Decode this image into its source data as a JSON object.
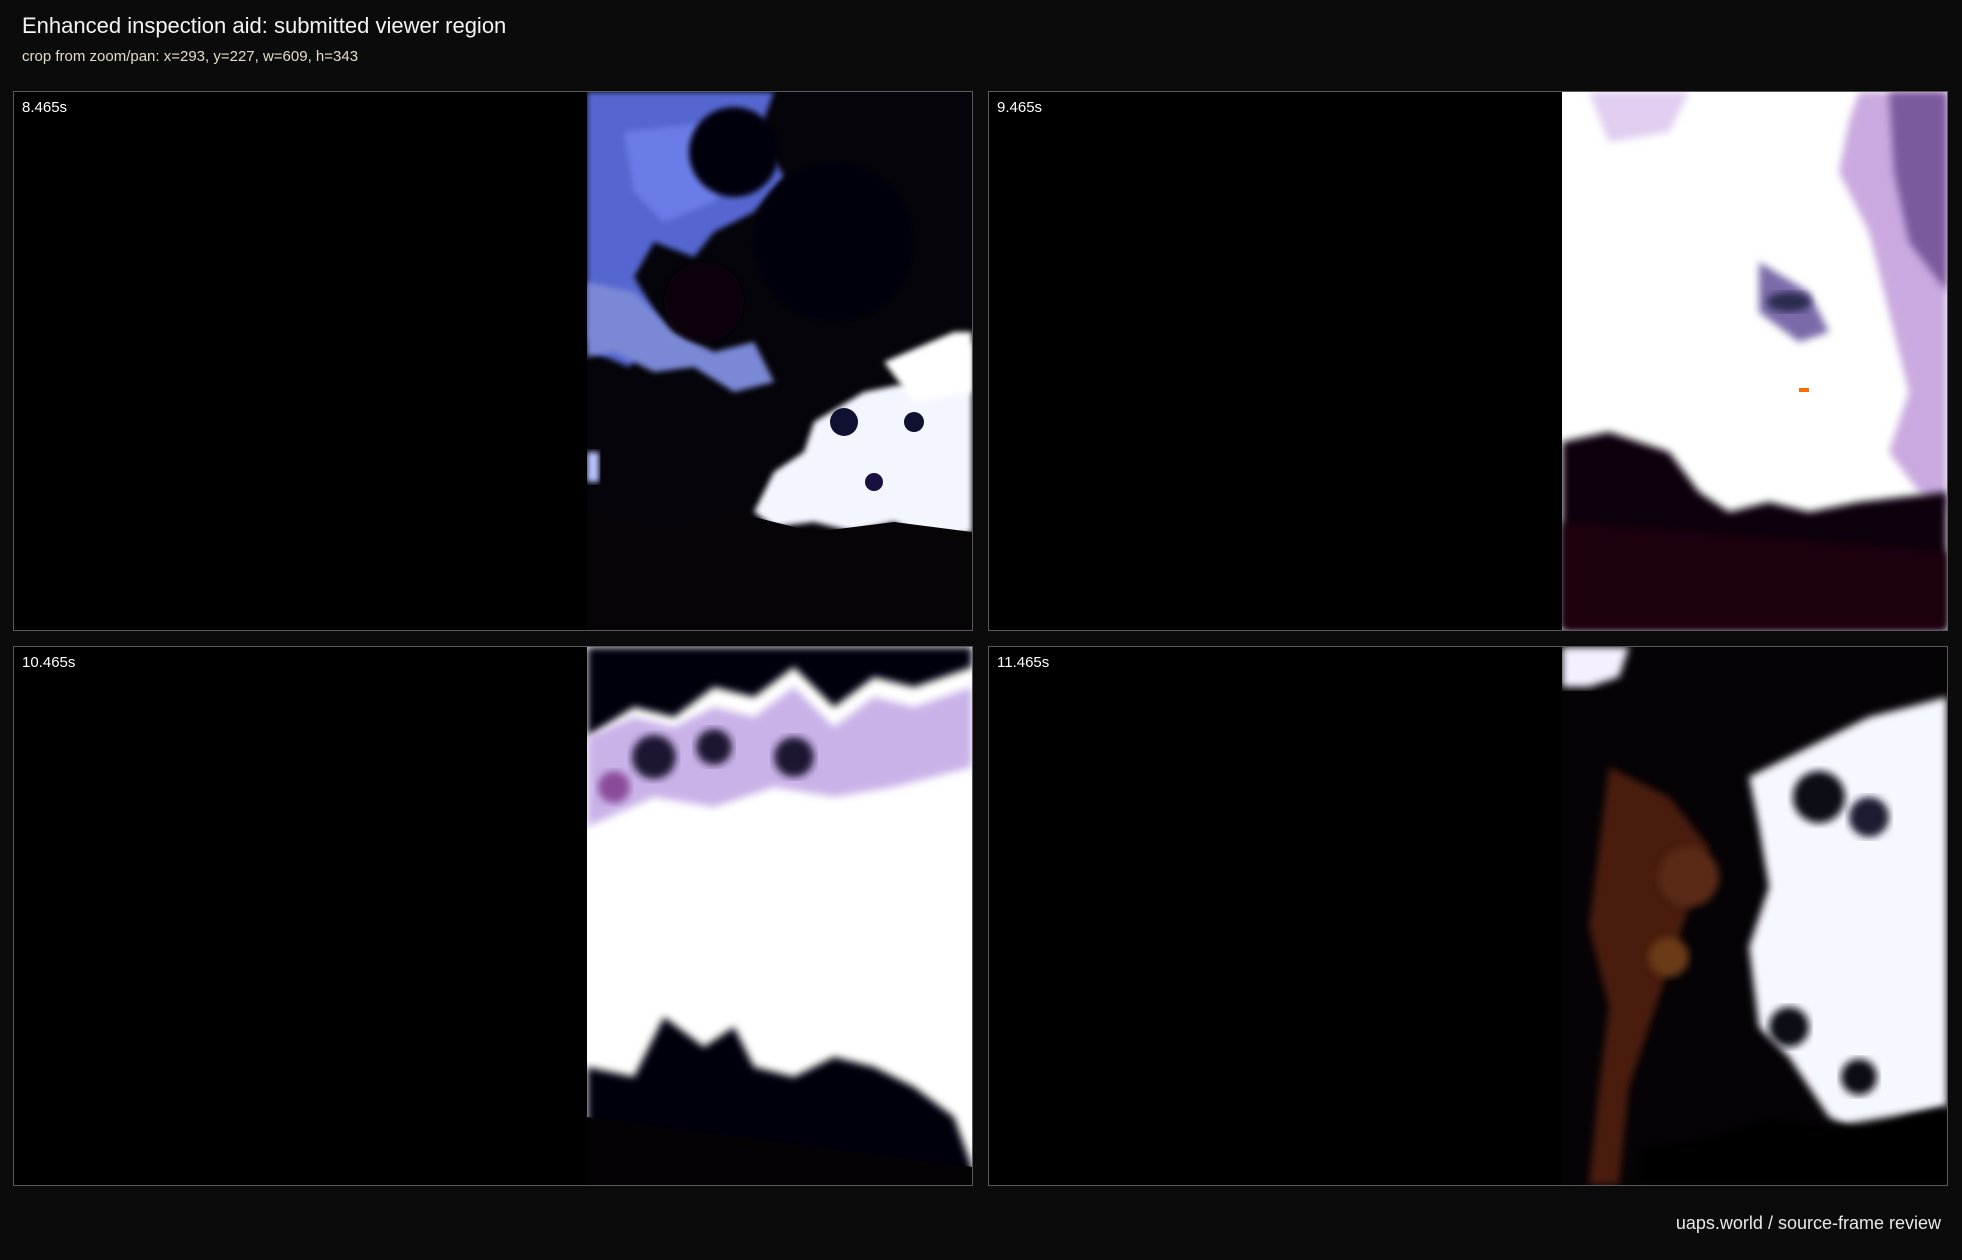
{
  "header": {
    "title": "Enhanced inspection aid: submitted viewer region",
    "subtitle": "crop from zoom/pan: x=293, y=227, w=609, h=343"
  },
  "frames": [
    {
      "timestamp": "8.465s"
    },
    {
      "timestamp": "9.465s"
    },
    {
      "timestamp": "10.465s"
    },
    {
      "timestamp": "11.465s"
    }
  ],
  "footer": {
    "credit": "uaps.world / source-frame review"
  },
  "colors": {
    "background": "#0b0b0b",
    "panel_border": "#5a5a5a",
    "sky_blue": "#5b6fd6",
    "cloud_white": "#ffffff",
    "foliage_dark": "#080610",
    "magenta_fringe": "#b04aa8",
    "rust_brown": "#5a1f10"
  }
}
